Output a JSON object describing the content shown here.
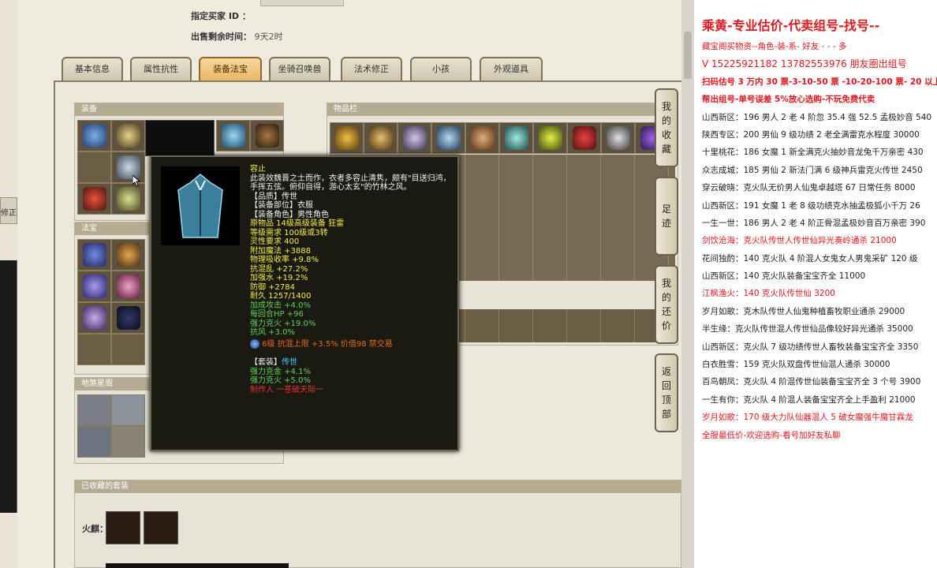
{
  "meta": {
    "seller_label": "指定买家 ID ：",
    "seller_value": "",
    "remaining_label": "出售剩余时间：",
    "remaining_value": "9天2时"
  },
  "tabs": [
    "基本信息",
    "属性抗性",
    "装备法宝",
    "坐骑召唤兽",
    "法术修正",
    "小孩",
    "外观道具"
  ],
  "active_tab": "装备法宝",
  "sections": {
    "equipment": "装备",
    "inventory": "物品栏",
    "treasure": "法宝",
    "ground_star": "地煞星阁",
    "collected_sets": "已收藏的套装",
    "huoqi_label": "火麒："
  },
  "left_edge_label": "修正",
  "side_buttons": [
    {
      "label": [
        "我",
        "的",
        "收",
        "藏"
      ],
      "name": "my-favorites-button"
    },
    {
      "label": [
        "足",
        "迹"
      ],
      "name": "footprint-button"
    },
    {
      "label": [
        "我",
        "的",
        "还",
        "价"
      ],
      "name": "my-offers-button"
    },
    {
      "label": [
        "返",
        "回",
        "顶",
        "部"
      ],
      "name": "back-to-top-button"
    }
  ],
  "tooltip": {
    "name": "容止",
    "desc": "此装效魏晋之士而作，衣者多容止清隽，颇有\"目送归鸿，手挥五弦。俯仰自得，游心太玄\"的竹林之风。",
    "quality": "【品质】传世",
    "part": "【装备部位】衣服",
    "role": "【装备角色】男性角色",
    "attrs": [
      "原物品 14级高级装备 狂雷",
      "等级需求 100级或3转",
      "灵性要求 400",
      "附加魔法 +3888",
      "物理吸收率 +9.8%",
      "抗混乱 +27.2%",
      "加强水 +19.2%",
      "防御 +2784",
      "耐久 1257/1400"
    ],
    "green_attrs": [
      "加成攻击 +4.0%",
      "每回合HP +96",
      "强力克火 +19.0%",
      "抗风 +3.0%"
    ],
    "gem_line": "6级 抗混上限 +3.5% 价值98 禁交易",
    "set_label": "【套装】",
    "set_value": "传世",
    "set_attrs": [
      "强力克金 +4.1%",
      "强力克火 +5.0%"
    ],
    "maker": "制作人 一苍破天际一"
  },
  "doc": {
    "title": "乘黄-专业估价-代卖组号-找号--",
    "line1": "藏宝阁买物资--角色-装-系-  好友 - - - 多",
    "line2": "V 15225921182   13782553976 朋友圈出组号",
    "line3": "扫码估号 3 万内 30 票-3-10-50 票  -10-20-100 票- 20 以上",
    "line4": "帮出组号-单号误差 5%放心选购-不玩免费代卖",
    "listings": [
      {
        "text": "山西新区：196 男人 2 老 4 阶忽 35.4 强 52.5 孟极妙音 540",
        "red": false
      },
      {
        "text": "陕西专区：200 男仙 9 级功绩 2 老全满雷克水程度 30000",
        "red": false
      },
      {
        "text": "十里桃花：186 女魔 1 新全满克火抽妙音龙兔千万亲密 430",
        "red": false
      },
      {
        "text": "众志成城：185 男仙 2 新法门满 6 级神兵雷克火传世 2450",
        "red": false
      },
      {
        "text": "穿云破晓：克火队无价男人仙鬼卓越塔 67 日常任务 8000",
        "red": false
      },
      {
        "text": "山西新区：191 女魔 1 老 8 级功绩克水抽孟极狐小千万 26",
        "red": false
      },
      {
        "text": "一生一世：186 男人 2 老 4 阶正骨混孟极妙音百万亲密 390",
        "red": false
      },
      {
        "text": "剑饮沧海：克火队传世人传世仙异光奏岭通杀 21000",
        "red": true
      },
      {
        "text": "花间独酌：140 克火队 4 阶混人女鬼女人男鬼采矿 120 级",
        "red": false
      },
      {
        "text": "山西新区：140 克火队装备宝宝齐全 11000",
        "red": false
      },
      {
        "text": "江枫渔火：140 克火队传世仙 3200",
        "red": true
      },
      {
        "text": "岁月如歌：克木队传世人仙鬼种植畜牧职业通杀 29000",
        "red": false
      },
      {
        "text": "半生缘：克火队传世混人传世仙品像较好异光通杀 35000",
        "red": false
      },
      {
        "text": "山西新区：克火队 7 级功绩传世人畜牧装备宝宝齐全 3350",
        "red": false
      },
      {
        "text": "白衣胜雪：159 克火队双盘传世仙混人通杀 30000",
        "red": false
      },
      {
        "text": "百鸟朝凤：克火队 4 阶混传世仙装备宝宝齐全 3 个号 3900",
        "red": false
      },
      {
        "text": "一生有你：克火队 4 阶混人装备宝宝齐全上手盈利 21000",
        "red": false
      },
      {
        "text": "岁月如歌：170 级大力队仙器混人 5 破女魔强牛魔甘霖龙",
        "red": true
      }
    ],
    "footer": "全服最低价-欢迎选购-看号加好友私聊"
  }
}
